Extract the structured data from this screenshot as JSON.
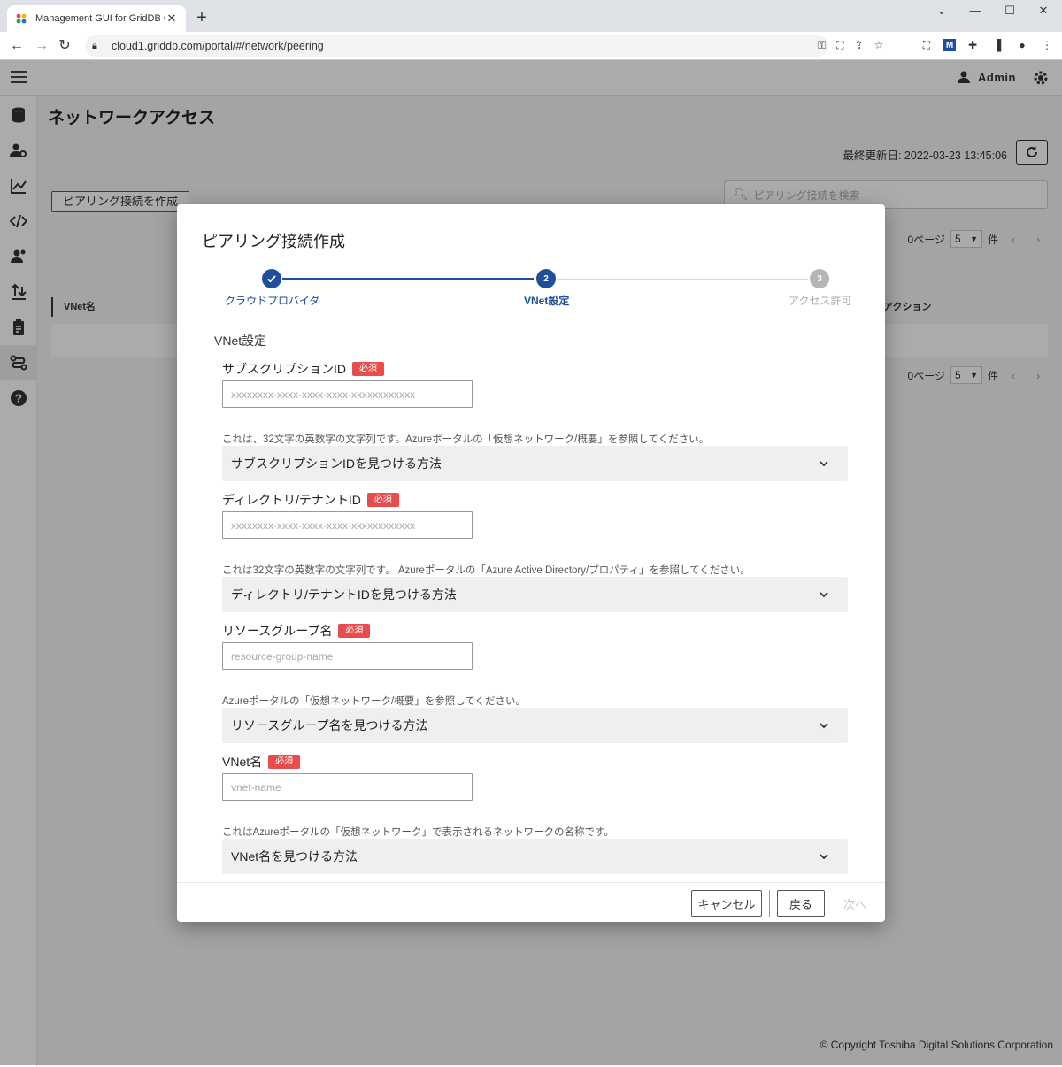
{
  "browser": {
    "tab_title": "Management GUI for GridDB Clo",
    "url": "cloud1.griddb.com/portal/#/network/peering"
  },
  "appbar": {
    "user_name": "Admin"
  },
  "page": {
    "title": "ネットワークアクセス",
    "last_updated": "最終更新日: 2022-03-23 13:45:06",
    "create_button": "ピアリング接続を作成",
    "search_placeholder": "ピアリング接続を検索",
    "pager": {
      "page_label": "0ページ",
      "page_size": "5",
      "count_unit": "件"
    },
    "table": {
      "col_vnet": "VNet名",
      "col_action": "アクション"
    },
    "footer": "© Copyright Toshiba Digital Solutions Corporation"
  },
  "dialog": {
    "title": "ピアリング接続作成",
    "steps": [
      {
        "number": "1",
        "label": "クラウドプロバイダ",
        "state": "done"
      },
      {
        "number": "2",
        "label": "VNet設定",
        "state": "active"
      },
      {
        "number": "3",
        "label": "アクセス許可",
        "state": "pending"
      }
    ],
    "section_title": "VNet設定",
    "required_badge": "必須",
    "fields": [
      {
        "label": "サブスクリプションID",
        "placeholder": "xxxxxxxx-xxxx-xxxx-xxxx-xxxxxxxxxxxx",
        "hint": "これは、32文字の英数字の文字列です。Azureポータルの「仮想ネットワーク/概要」を参照してください。",
        "accordion": "サブスクリプションIDを見つける方法"
      },
      {
        "label": "ディレクトリ/テナントID",
        "placeholder": "xxxxxxxx-xxxx-xxxx-xxxx-xxxxxxxxxxxx",
        "hint": "これは32文字の英数字の文字列です。 Azureポータルの「Azure Active Directory/プロパティ」を参照してください。",
        "accordion": "ディレクトリ/テナントIDを見つける方法"
      },
      {
        "label": "リソースグループ名",
        "placeholder": "resource-group-name",
        "hint": "Azureポータルの「仮想ネットワーク/概要」を参照してください。",
        "accordion": "リソースグループ名を見つける方法"
      },
      {
        "label": "VNet名",
        "placeholder": "vnet-name",
        "hint": "これはAzureポータルの「仮想ネットワーク」で表示されるネットワークの名称です。",
        "accordion": "VNet名を見つける方法"
      }
    ],
    "buttons": {
      "cancel": "キャンセル",
      "back": "戻る",
      "next": "次へ"
    }
  },
  "colors": {
    "primary": "#1f4e9c",
    "required": "#e84c4c",
    "step_pending": "#b5b5b5"
  }
}
